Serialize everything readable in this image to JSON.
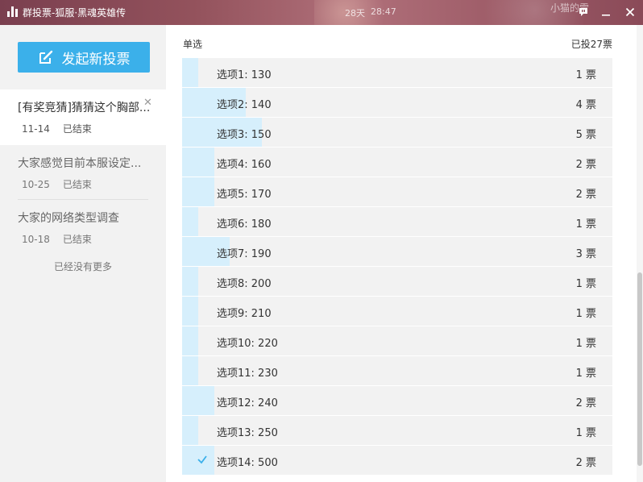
{
  "window": {
    "title": "群投票-狐服·黑魂英雄传",
    "bg_text_1": "28天",
    "bg_text_2": "28:47",
    "bg_text_3": "小猫的雪"
  },
  "sidebar": {
    "new_vote_label": "发起新投票",
    "items": [
      {
        "title": "[有奖竞猜]猜猜这个胸部...",
        "date": "11-14",
        "status": "已结束"
      },
      {
        "title": "大家感觉目前本服设定...",
        "date": "10-25",
        "status": "已结束"
      },
      {
        "title": "大家的网络类型调查",
        "date": "10-18",
        "status": "已结束"
      }
    ],
    "no_more": "已经没有更多"
  },
  "main": {
    "vote_type": "单选",
    "total_votes": "已投27票",
    "options": [
      {
        "label": "选项1: 130",
        "votes": "1 票",
        "fraction": 0.037,
        "checked": false
      },
      {
        "label": "选项2: 140",
        "votes": "4 票",
        "fraction": 0.148,
        "checked": false
      },
      {
        "label": "选项3: 150",
        "votes": "5 票",
        "fraction": 0.185,
        "checked": false
      },
      {
        "label": "选项4: 160",
        "votes": "2 票",
        "fraction": 0.074,
        "checked": false
      },
      {
        "label": "选项5: 170",
        "votes": "2 票",
        "fraction": 0.074,
        "checked": false
      },
      {
        "label": "选项6: 180",
        "votes": "1 票",
        "fraction": 0.037,
        "checked": false
      },
      {
        "label": "选项7: 190",
        "votes": "3 票",
        "fraction": 0.111,
        "checked": false
      },
      {
        "label": "选项8: 200",
        "votes": "1 票",
        "fraction": 0.037,
        "checked": false
      },
      {
        "label": "选项9: 210",
        "votes": "1 票",
        "fraction": 0.037,
        "checked": false
      },
      {
        "label": "选项10: 220",
        "votes": "1 票",
        "fraction": 0.037,
        "checked": false
      },
      {
        "label": "选项11: 230",
        "votes": "1 票",
        "fraction": 0.037,
        "checked": false
      },
      {
        "label": "选项12: 240",
        "votes": "2 票",
        "fraction": 0.074,
        "checked": false
      },
      {
        "label": "选项13: 250",
        "votes": "1 票",
        "fraction": 0.037,
        "checked": false
      },
      {
        "label": "选项14: 500",
        "votes": "2 票",
        "fraction": 0.074,
        "checked": true
      }
    ]
  },
  "colors": {
    "accent": "#3bb0ea",
    "bar_fill": "#d6effc",
    "row_bg": "#f2f2f2",
    "titlebar": "#93525c"
  },
  "icons": {
    "app": "bar-chart-icon",
    "new_vote": "edit-icon",
    "feedback": "speech-bubble-icon",
    "minimize": "minimize-icon",
    "close": "close-icon",
    "selected": "check-icon"
  }
}
